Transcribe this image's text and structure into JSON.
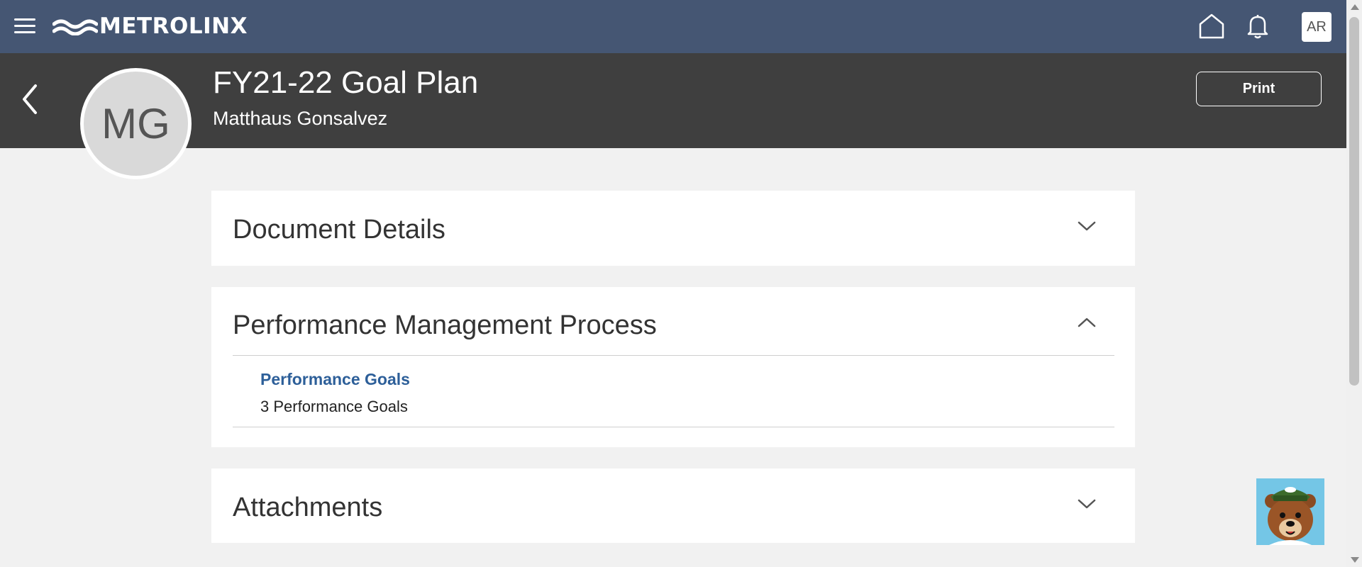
{
  "topbar": {
    "brand": "METROLINX",
    "user_initials": "AR",
    "icons": [
      "menu-icon",
      "home-icon",
      "bell-icon"
    ]
  },
  "header": {
    "title": "FY21-22 Goal Plan",
    "subtitle": "Matthaus Gonsalvez",
    "avatar_initials": "MG",
    "print_label": "Print"
  },
  "sections": [
    {
      "title": "Document Details",
      "expanded": false
    },
    {
      "title": "Performance Management Process",
      "expanded": true,
      "items": [
        {
          "link": "Performance Goals",
          "detail": "3 Performance Goals"
        }
      ]
    },
    {
      "title": "Attachments",
      "expanded": false
    }
  ],
  "colors": {
    "topbar": "#455673",
    "header": "#3f3f3f",
    "link": "#2d5f99",
    "background": "#f1f1f1"
  }
}
